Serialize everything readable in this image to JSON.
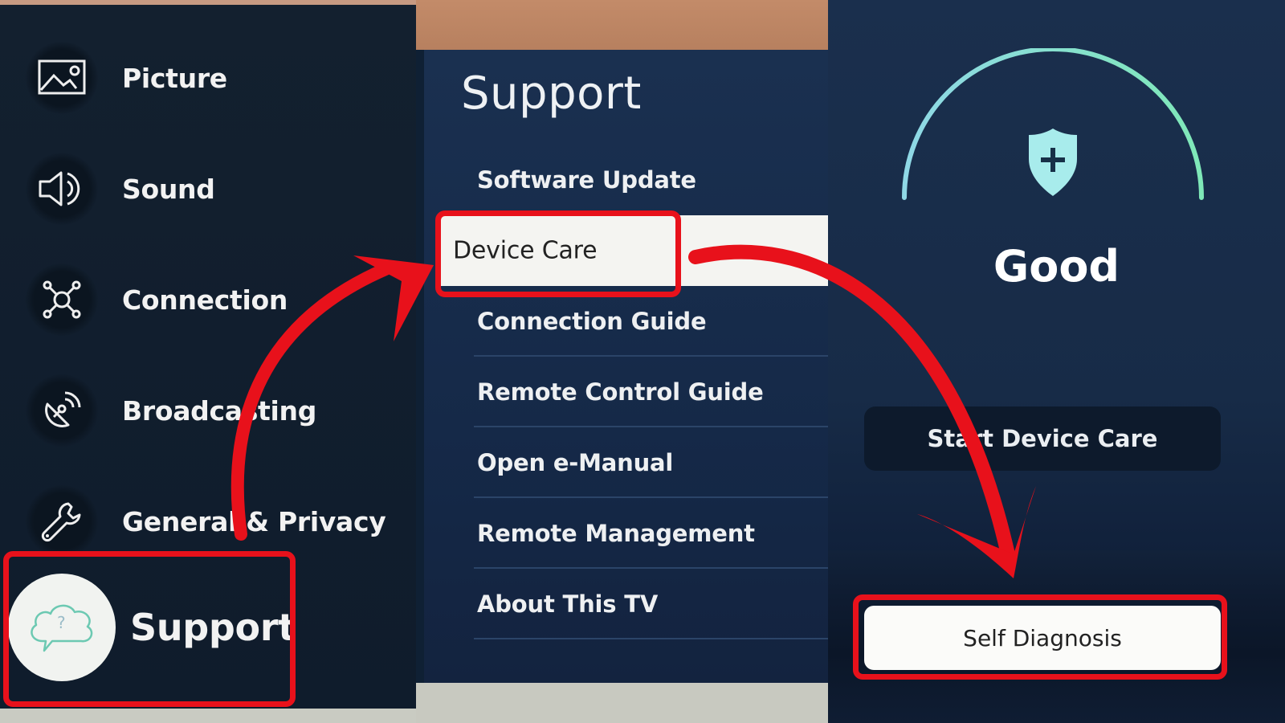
{
  "settings_menu": {
    "items": [
      {
        "label": "Picture",
        "icon": "picture-icon"
      },
      {
        "label": "Sound",
        "icon": "speaker-icon"
      },
      {
        "label": "Connection",
        "icon": "network-icon"
      },
      {
        "label": "Broadcasting",
        "icon": "satellite-dish-icon"
      },
      {
        "label": "General & Privacy",
        "icon": "wrench-icon"
      }
    ],
    "selected": {
      "label": "Support",
      "icon": "support-cloud-icon"
    }
  },
  "support_menu": {
    "title": "Support",
    "items": [
      {
        "label": "Software Update"
      },
      {
        "label": "Device Care",
        "selected": true
      },
      {
        "label": "Connection Guide"
      },
      {
        "label": "Remote Control Guide"
      },
      {
        "label": "Open e-Manual"
      },
      {
        "label": "Remote Management"
      },
      {
        "label": "About This TV"
      }
    ]
  },
  "device_care": {
    "status": "Good",
    "status_icon": "shield-plus-icon",
    "start_button": "Start Device Care",
    "self_diagnosis_button": "Self Diagnosis"
  },
  "colors": {
    "annotation_red": "#e8111b",
    "gauge_start": "#8fd8e6",
    "gauge_end": "#7fe8b8",
    "panel_navy": "#172b47"
  }
}
